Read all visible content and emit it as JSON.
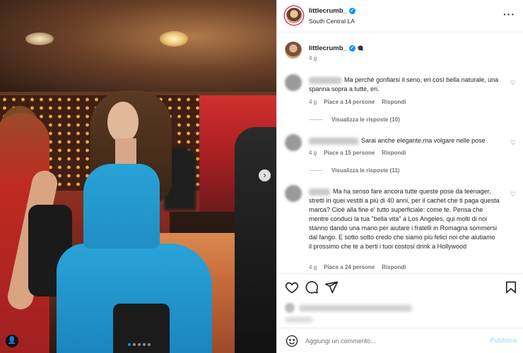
{
  "post": {
    "username": "littlecrumb_",
    "location": "South Central LA",
    "caption_emoji": "🎕",
    "caption_time": "4 g"
  },
  "icons": {
    "more": "more-options-icon",
    "verified": "verified-badge-icon",
    "heart": "heart-icon",
    "comment": "comment-icon",
    "share": "share-icon",
    "save": "bookmark-icon",
    "emoji": "emoji-icon",
    "next": "chevron-right-icon",
    "user_tag": "user-tag-icon"
  },
  "comments": [
    {
      "text": "Ma perché gonfiarsi il seno, eri così bella naturale, una spanna sopra a tutte, eri.",
      "time": "4 g",
      "likes": "Piace a 14 persone",
      "reply": "Rispondi",
      "view_replies": "Visualizza le risposte (10)"
    },
    {
      "text": "Sarai anche elegante,ma volgare nelle pose",
      "time": "4 g",
      "likes": "Piace a 15 persone",
      "reply": "Rispondi",
      "view_replies": "Visualizza le risposte (11)"
    },
    {
      "text": "Ma ha senso fare ancora tutte queste pose da teenager, stretti in quei vestiti a più di 40 anni, per il cachet che ti paga questa marca? Cioè alla fine e' tutto superficiale: come te. Pensa che mentre conduci la tua \"bella vita\" a Los Angeles, qui molti di noi stanno dando una mano per aiutare i fratelli in Romagna sommersi dal fango. E sotto sotto credo che siamo più felici noi che aiutiamo il prossimo che te a berti i tuoi costosi drink a Hollywood",
      "time": "4 g",
      "likes": "Piace a 24 persone",
      "reply": "Rispondi"
    }
  ],
  "composer": {
    "placeholder": "Aggiungi un commento...",
    "publish_label": "Pubblica"
  },
  "colors": {
    "accent": "#0095f6",
    "publish_disabled": "#b2dffc",
    "meta": "#737373"
  }
}
